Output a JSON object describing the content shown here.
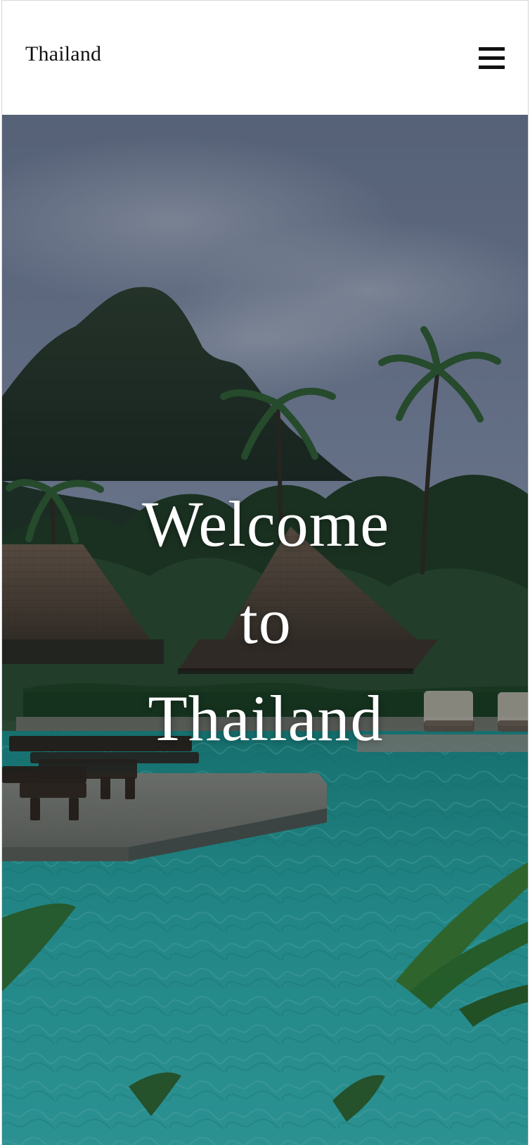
{
  "header": {
    "brand": "Thailand",
    "menu_icon": "hamburger-menu-icon"
  },
  "hero": {
    "headline_lines": [
      "Welcome",
      "to",
      "Thailand"
    ],
    "image_semantic": "tropical-resort-pool-with-limestone-mountain-background"
  },
  "colors": {
    "header_bg": "#ffffff",
    "brand_text": "#111111",
    "hero_text": "#ffffff",
    "water": "#2aa7a6",
    "sky": "#6f7b93"
  }
}
